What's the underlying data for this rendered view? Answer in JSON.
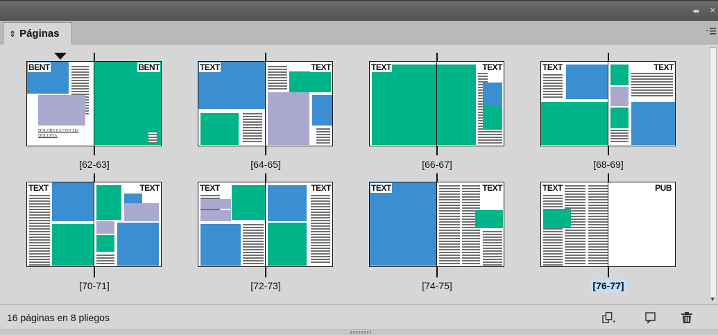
{
  "panel": {
    "tab_title": "Páginas",
    "status_text": "16 páginas en 8 pliegos"
  },
  "icons": {
    "collapse": "double-chevron-left-icon",
    "close": "close-icon",
    "panel_menu": "hamburger-menu-icon",
    "tab_arrows": "up-down-arrows-icon",
    "page_size": "page-size-icon",
    "new_page": "new-page-icon",
    "trash": "trash-icon"
  },
  "colors": {
    "blue_block": "#3b8fd0",
    "green_block": "#00b489",
    "lavender_block": "#aaaad0",
    "selection_highlight": "#bfe0ff"
  },
  "spreads": [
    {
      "label": "[62-63]",
      "left_tag": "BENT",
      "right_tag": "BENT",
      "selected": false,
      "caption": "DOLORE EA CON SEI DOLUPTA"
    },
    {
      "label": "[64-65]",
      "left_tag": "TEXT",
      "right_tag": "TEXT",
      "selected": false
    },
    {
      "label": "[66-67]",
      "left_tag": "TEXT",
      "right_tag": "TEXT",
      "selected": false
    },
    {
      "label": "[68-69]",
      "left_tag": "TEXT",
      "right_tag": "TEXT",
      "selected": false
    },
    {
      "label": "[70-71]",
      "left_tag": "TEXT",
      "right_tag": "TEXT",
      "selected": false
    },
    {
      "label": "[72-73]",
      "left_tag": "TEXT",
      "right_tag": "TEXT",
      "selected": false
    },
    {
      "label": "[74-75]",
      "left_tag": "TEXT",
      "right_tag": "TEXT",
      "selected": false
    },
    {
      "label": "[76-77]",
      "left_tag": "TEXT",
      "right_tag": "PUB",
      "selected": true
    }
  ]
}
